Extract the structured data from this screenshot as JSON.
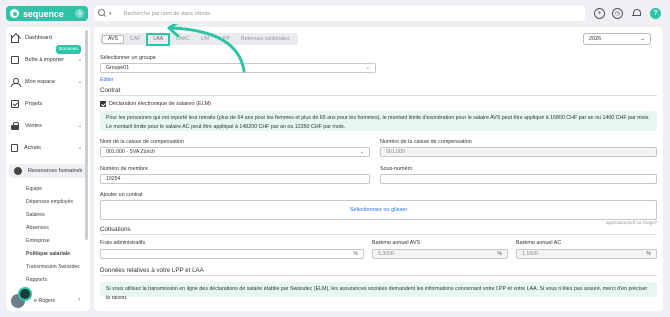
{
  "brand": {
    "name": "sequence",
    "badge": "à",
    "accent": "#2ec4a7"
  },
  "search": {
    "placeholder": "Recherche par nom de dans clients"
  },
  "top_icons": [
    "add-icon",
    "history-icon",
    "bell-icon",
    "help-icon"
  ],
  "help_label": "?",
  "sidebar": {
    "items": [
      {
        "label": "Dashboard",
        "icon": "home-icon"
      },
      {
        "label": "Boîte à importer",
        "icon": "inbox-icon"
      },
      {
        "label": "Mon espace",
        "icon": "user-icon"
      },
      {
        "label": "Projets",
        "icon": "check-icon"
      },
      {
        "label": "Ventes",
        "icon": "lock-icon"
      },
      {
        "label": "Achats",
        "icon": "document-icon"
      },
      {
        "label": "Ressources humaines",
        "icon": "hr-icon"
      }
    ],
    "new_badge": "Nouveau",
    "subitems": [
      "Equipe",
      "Dépenses employés",
      "Salaires",
      "Absences",
      "Entreprise",
      "Politique salariale",
      "Transmission Swissdec",
      "Rapports"
    ],
    "user_name": "e Rogers"
  },
  "tabs": [
    "AVS",
    "CAF",
    "LAA",
    "LAAC",
    "IJM",
    "LPP",
    "Retenues cantonales"
  ],
  "active_tab": "AVS",
  "highlighted_tab": "LAA",
  "year": "2026",
  "group": {
    "label": "Sélectionner un groupe",
    "value": "Groupe01",
    "edit": "Editer"
  },
  "contract": {
    "title": "Contrat",
    "elm_label": "Déclaration électronique de salaires (ELM)",
    "info": "Pour les personnes qui ont reporté leur retraite (plus de 64 ans pour les femmes et plus de 65 ans pour les hommes), le montant limite d'exonération pour le salaire AVS peut être appliqué à 16800 CHF par an ou 1400 CHF par mois. Le montant limite pour le salaire AC peut être appliqué à 148200 CHF par an ou 12350 CHF par mois.",
    "caisse_name_label": "Nom de la caisse de compensation",
    "caisse_name_value": "001.000 - SVA Zürich",
    "caisse_number_label": "Numéro de la caisse de compensation",
    "caisse_number_value": "001.000",
    "member_label": "Numéro de membre",
    "member_value": "10254",
    "sub_number_label": "Sous-numéro",
    "sub_number_value": "",
    "add_contract_label": "Ajouter un contrat",
    "upload_text": "Sélectionnez ou glisser",
    "upload_hint": "application/pdf ou image/*"
  },
  "cotisations": {
    "title": "Cotisations",
    "admin_label": "Frais administratifs",
    "admin_value": "",
    "avs_label": "Barème annuel AVS",
    "avs_value": "5,3000",
    "ac_label": "Barème annuel AC",
    "ac_value": "1,1000",
    "unit": "%"
  },
  "lpp": {
    "title": "Données relatives à votre LPP et LAA",
    "info": "Si vous utilisez la transmission en ligne des déclarations de salaire établie par Swissdec (ELM), les assurances sociales demandent les informations concernant votre LPP et votre LAA. Si vous n'êtes pas assuré, merci d'en préciser la raison."
  }
}
